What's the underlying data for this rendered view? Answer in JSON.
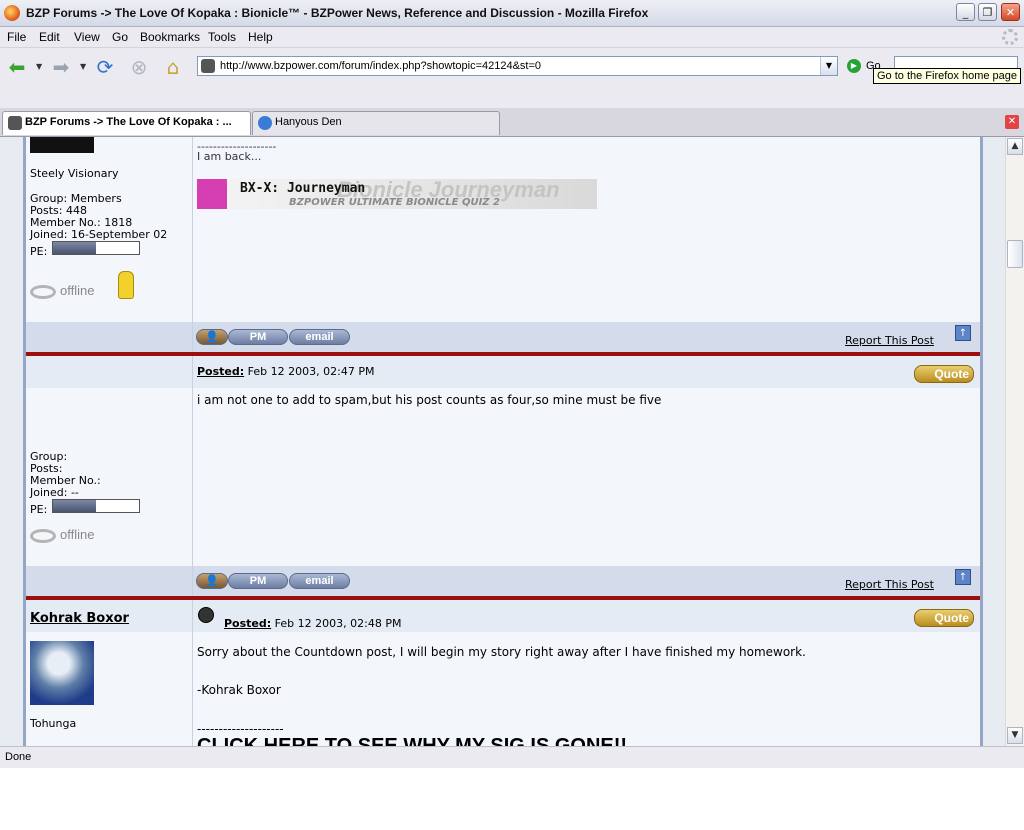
{
  "window": {
    "title": "BZP Forums -> The Love Of Kopaka : Bionicle™ - BZPower News, Reference and Discussion - Mozilla Firefox",
    "minimize": "_",
    "maximize": "❐",
    "close": "✕"
  },
  "menu": [
    "File",
    "Edit",
    "View",
    "Go",
    "Bookmarks",
    "Tools",
    "Help"
  ],
  "address": {
    "url": "http://www.bzpower.com/forum/index.php?showtopic=42124&st=0",
    "go_label": "Go",
    "tooltip": "Go to the Firefox home page"
  },
  "tabs": [
    {
      "label": "BZP Forums -> The Love Of Kopaka : ...",
      "active": true
    },
    {
      "label": "Hanyous Den",
      "active": false
    }
  ],
  "posts": [
    {
      "title": "Steely Visionary",
      "group": "Group: Members",
      "posts": "Posts: 448",
      "member_no": "Member No.: 1818",
      "joined": "Joined: 16-September 02",
      "pe_label": "PE:",
      "pe_fraction": 0.5,
      "offline": "offline",
      "sig_line": "--------------------",
      "sig_text": "I am back...",
      "banner_title": "BX-X: Journeyman",
      "banner_watermark": "Bionicle Journeyman",
      "banner_subtitle": "BZPOWER ULTIMATE BIONICLE QUIZ 2",
      "report": "Report This Post"
    },
    {
      "posted_label": "Posted:",
      "posted_date": "Feb 12 2003, 02:47 PM",
      "quote": "Quote",
      "body": "i am not one to add to spam,but his post counts as four,so mine must be five",
      "group": "Group:",
      "posts": "Posts:",
      "member_no": "Member No.:",
      "joined": "Joined: --",
      "pe_label": "PE:",
      "pe_fraction": 0.5,
      "offline": "offline",
      "report": "Report This Post"
    },
    {
      "author": "Kohrak Boxor",
      "posted_label": "Posted:",
      "posted_date": "Feb 12 2003, 02:48 PM",
      "quote": "Quote",
      "body1": "Sorry about the Countdown post, I will begin my story right away after I have finished my homework.",
      "body2": "-Kohrak Boxor",
      "sig_line": "--------------------",
      "sig_text": "CLICK HERE TO SEE WHY MY SIG IS GONE!!",
      "title": "Tohunga"
    }
  ],
  "buttons": {
    "pm": "PM",
    "email": "email",
    "top": "↑"
  },
  "status": "Done",
  "colors": {
    "divider": "#9b0f0f",
    "row_bg": "#f3f6fb",
    "action_bg": "#d4dceb"
  }
}
